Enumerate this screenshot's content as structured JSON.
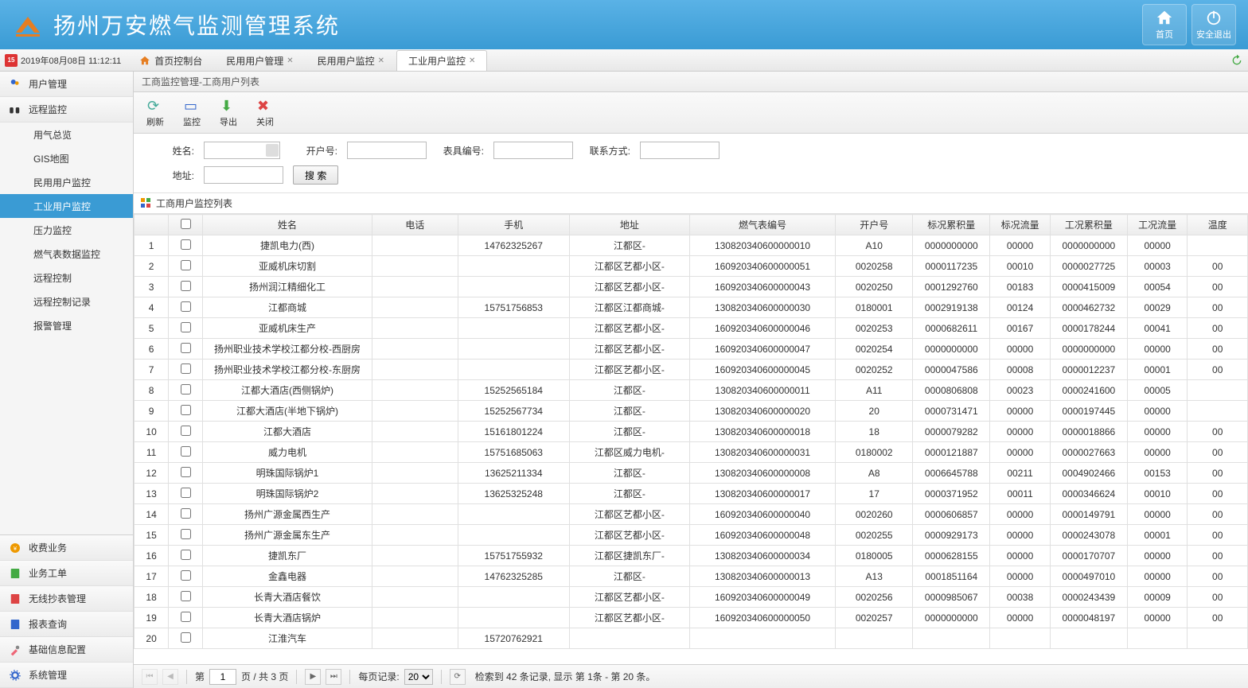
{
  "header": {
    "title": "扬州万安燃气监测管理系统",
    "home_btn": "首页",
    "logout_btn": "安全退出"
  },
  "datetime": "2019年08月08日 11:12:11",
  "tabs": [
    {
      "label": "首页控制台",
      "home": true
    },
    {
      "label": "民用用户管理",
      "closable": true
    },
    {
      "label": "民用用户监控",
      "closable": true
    },
    {
      "label": "工业用户监控",
      "closable": true,
      "active": true
    }
  ],
  "sidebar": {
    "groups_top": [
      {
        "icon": "users",
        "label": "用户管理"
      },
      {
        "icon": "binoculars",
        "label": "远程监控"
      }
    ],
    "monitor_items": [
      "用气总览",
      "GIS地图",
      "民用用户监控",
      "工业用户监控",
      "压力监控",
      "燃气表数据监控",
      "远程控制",
      "远程控制记录",
      "报警管理"
    ],
    "active_item": "工业用户监控",
    "groups_bottom": [
      {
        "icon": "money",
        "label": "收费业务"
      },
      {
        "icon": "order",
        "label": "业务工单"
      },
      {
        "icon": "wireless",
        "label": "无线抄表管理"
      },
      {
        "icon": "report",
        "label": "报表查询"
      },
      {
        "icon": "tools",
        "label": "基础信息配置"
      },
      {
        "icon": "gear",
        "label": "系统管理"
      }
    ]
  },
  "breadcrumb": "工商监控管理-工商用户列表",
  "toolbar": [
    {
      "icon": "refresh",
      "label": "刷新",
      "color": "#4a9"
    },
    {
      "icon": "monitor",
      "label": "监控",
      "color": "#36c"
    },
    {
      "icon": "export",
      "label": "导出",
      "color": "#4a4"
    },
    {
      "icon": "close",
      "label": "关闭",
      "color": "#d44"
    }
  ],
  "search": {
    "labels": {
      "name": "姓名:",
      "account": "开户号:",
      "meter": "表具编号:",
      "contact": "联系方式:",
      "address": "地址:"
    },
    "btn": "搜 索"
  },
  "grid_title": "工商用户监控列表",
  "columns": [
    "",
    "",
    "姓名",
    "电话",
    "手机",
    "地址",
    "燃气表编号",
    "开户号",
    "标况累积量",
    "标况流量",
    "工况累积量",
    "工况流量",
    "温度"
  ],
  "rows": [
    {
      "n": 1,
      "name": "捷凯电力(西)",
      "phone": "",
      "mobile": "14762325267",
      "addr": "江都区-",
      "meter": "130820340600000010",
      "acc": "A10",
      "c1": "0000000000",
      "c2": "00000",
      "c3": "0000000000",
      "c4": "00000",
      "c5": ""
    },
    {
      "n": 2,
      "name": "亚威机床切割",
      "phone": "",
      "mobile": "",
      "addr": "江都区艺都小区-",
      "meter": "160920340600000051",
      "acc": "0020258",
      "c1": "0000117235",
      "c2": "00010",
      "c3": "0000027725",
      "c4": "00003",
      "c5": "00"
    },
    {
      "n": 3,
      "name": "扬州润江精细化工",
      "phone": "",
      "mobile": "",
      "addr": "江都区艺都小区-",
      "meter": "160920340600000043",
      "acc": "0020250",
      "c1": "0001292760",
      "c2": "00183",
      "c3": "0000415009",
      "c4": "00054",
      "c5": "00"
    },
    {
      "n": 4,
      "name": "江都商城",
      "phone": "",
      "mobile": "15751756853",
      "addr": "江都区江都商城-",
      "meter": "130820340600000030",
      "acc": "0180001",
      "c1": "0002919138",
      "c2": "00124",
      "c3": "0000462732",
      "c4": "00029",
      "c5": "00"
    },
    {
      "n": 5,
      "name": "亚威机床生产",
      "phone": "",
      "mobile": "",
      "addr": "江都区艺都小区-",
      "meter": "160920340600000046",
      "acc": "0020253",
      "c1": "0000682611",
      "c2": "00167",
      "c3": "0000178244",
      "c4": "00041",
      "c5": "00"
    },
    {
      "n": 6,
      "name": "扬州职业技术学校江都分校-西厨房",
      "phone": "",
      "mobile": "",
      "addr": "江都区艺都小区-",
      "meter": "160920340600000047",
      "acc": "0020254",
      "c1": "0000000000",
      "c2": "00000",
      "c3": "0000000000",
      "c4": "00000",
      "c5": "00"
    },
    {
      "n": 7,
      "name": "扬州职业技术学校江都分校-东厨房",
      "phone": "",
      "mobile": "",
      "addr": "江都区艺都小区-",
      "meter": "160920340600000045",
      "acc": "0020252",
      "c1": "0000047586",
      "c2": "00008",
      "c3": "0000012237",
      "c4": "00001",
      "c5": "00"
    },
    {
      "n": 8,
      "name": "江都大酒店(西侧锅炉)",
      "phone": "",
      "mobile": "15252565184",
      "addr": "江都区-",
      "meter": "130820340600000011",
      "acc": "A11",
      "c1": "0000806808",
      "c2": "00023",
      "c3": "0000241600",
      "c4": "00005",
      "c5": ""
    },
    {
      "n": 9,
      "name": "江都大酒店(半地下锅炉)",
      "phone": "",
      "mobile": "15252567734",
      "addr": "江都区-",
      "meter": "130820340600000020",
      "acc": "20",
      "c1": "0000731471",
      "c2": "00000",
      "c3": "0000197445",
      "c4": "00000",
      "c5": ""
    },
    {
      "n": 10,
      "name": "江都大酒店",
      "phone": "",
      "mobile": "15161801224",
      "addr": "江都区-",
      "meter": "130820340600000018",
      "acc": "18",
      "c1": "0000079282",
      "c2": "00000",
      "c3": "0000018866",
      "c4": "00000",
      "c5": "00"
    },
    {
      "n": 11,
      "name": "威力电机",
      "phone": "",
      "mobile": "15751685063",
      "addr": "江都区威力电机-",
      "meter": "130820340600000031",
      "acc": "0180002",
      "c1": "0000121887",
      "c2": "00000",
      "c3": "0000027663",
      "c4": "00000",
      "c5": "00"
    },
    {
      "n": 12,
      "name": "明珠国际锅炉1",
      "phone": "",
      "mobile": "13625211334",
      "addr": "江都区-",
      "meter": "130820340600000008",
      "acc": "A8",
      "c1": "0006645788",
      "c2": "00211",
      "c3": "0004902466",
      "c4": "00153",
      "c5": "00"
    },
    {
      "n": 13,
      "name": "明珠国际锅炉2",
      "phone": "",
      "mobile": "13625325248",
      "addr": "江都区-",
      "meter": "130820340600000017",
      "acc": "17",
      "c1": "0000371952",
      "c2": "00011",
      "c3": "0000346624",
      "c4": "00010",
      "c5": "00"
    },
    {
      "n": 14,
      "name": "扬州广源金属西生产",
      "phone": "",
      "mobile": "",
      "addr": "江都区艺都小区-",
      "meter": "160920340600000040",
      "acc": "0020260",
      "c1": "0000606857",
      "c2": "00000",
      "c3": "0000149791",
      "c4": "00000",
      "c5": "00"
    },
    {
      "n": 15,
      "name": "扬州广源金属东生产",
      "phone": "",
      "mobile": "",
      "addr": "江都区艺都小区-",
      "meter": "160920340600000048",
      "acc": "0020255",
      "c1": "0000929173",
      "c2": "00000",
      "c3": "0000243078",
      "c4": "00001",
      "c5": "00"
    },
    {
      "n": 16,
      "name": "捷凯东厂",
      "phone": "",
      "mobile": "15751755932",
      "addr": "江都区捷凯东厂-",
      "meter": "130820340600000034",
      "acc": "0180005",
      "c1": "0000628155",
      "c2": "00000",
      "c3": "0000170707",
      "c4": "00000",
      "c5": "00"
    },
    {
      "n": 17,
      "name": "金鑫电器",
      "phone": "",
      "mobile": "14762325285",
      "addr": "江都区-",
      "meter": "130820340600000013",
      "acc": "A13",
      "c1": "0001851164",
      "c2": "00000",
      "c3": "0000497010",
      "c4": "00000",
      "c5": "00"
    },
    {
      "n": 18,
      "name": "长青大酒店餐饮",
      "phone": "",
      "mobile": "",
      "addr": "江都区艺都小区-",
      "meter": "160920340600000049",
      "acc": "0020256",
      "c1": "0000985067",
      "c2": "00038",
      "c3": "0000243439",
      "c4": "00009",
      "c5": "00"
    },
    {
      "n": 19,
      "name": "长青大酒店锅炉",
      "phone": "",
      "mobile": "",
      "addr": "江都区艺都小区-",
      "meter": "160920340600000050",
      "acc": "0020257",
      "c1": "0000000000",
      "c2": "00000",
      "c3": "0000048197",
      "c4": "00000",
      "c5": "00"
    },
    {
      "n": 20,
      "name": "江淮汽车",
      "phone": "",
      "mobile": "15720762921",
      "addr": "",
      "meter": "",
      "acc": "",
      "c1": "",
      "c2": "",
      "c3": "",
      "c4": "",
      "c5": ""
    }
  ],
  "pager": {
    "page_label_pre": "第",
    "page": "1",
    "page_label_mid": "页 / 共 3 页",
    "perpage_label": "每页记录:",
    "perpage": "20",
    "summary": "检索到 42 条记录, 显示 第 1条 - 第 20 条。"
  }
}
